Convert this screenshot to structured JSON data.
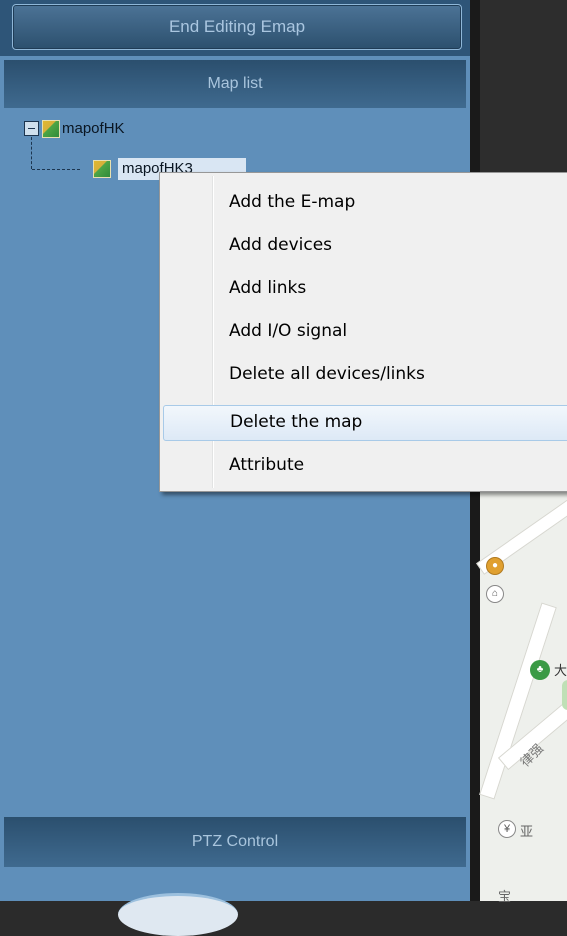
{
  "toolbar": {
    "end_editing_label": "End Editing Emap"
  },
  "map_list": {
    "header": "Map list",
    "tree": [
      {
        "label": "mapofHK",
        "expanded": true,
        "icon": "map-icon"
      },
      {
        "label": "mapofHK3",
        "selected": true,
        "icon": "map-icon"
      }
    ]
  },
  "context_menu": {
    "items": [
      {
        "label": "Add the E-map"
      },
      {
        "label": "Add devices"
      },
      {
        "label": "Add links"
      },
      {
        "label": "Add I/O signal"
      },
      {
        "label": "Delete all devices/links"
      },
      {
        "label": "Delete the map",
        "highlighted": true
      },
      {
        "label": "Attribute"
      }
    ]
  },
  "ptz": {
    "header": "PTZ Control"
  },
  "map_labels": {
    "road_label": "律强",
    "poi_label": "亚",
    "bottom_label": "宝",
    "green_label": "大"
  },
  "colors": {
    "panel_bg": "#5f8fba",
    "header_bg": "#2e5578",
    "menu_bg": "#f0f0f0",
    "highlight_border": "#a8cae8"
  }
}
